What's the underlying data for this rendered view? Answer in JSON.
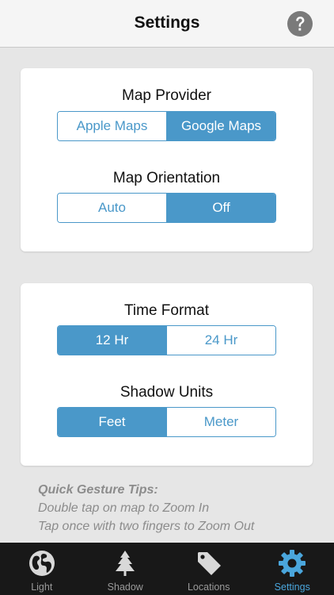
{
  "header": {
    "title": "Settings",
    "help_icon": "question-mark-icon"
  },
  "sections": {
    "map_provider": {
      "label": "Map Provider",
      "options": [
        "Apple Maps",
        "Google Maps"
      ],
      "selected": "Google Maps"
    },
    "map_orientation": {
      "label": "Map Orientation",
      "options": [
        "Auto",
        "Off"
      ],
      "selected": "Off"
    },
    "time_format": {
      "label": "Time Format",
      "options": [
        "12 Hr",
        "24 Hr"
      ],
      "selected": "12 Hr"
    },
    "shadow_units": {
      "label": "Shadow Units",
      "options": [
        "Feet",
        "Meter"
      ],
      "selected": "Feet"
    }
  },
  "tips": {
    "title": "Quick Gesture Tips:",
    "lines": [
      "Double tap on map to Zoom In",
      "Tap once with two fingers to Zoom Out"
    ]
  },
  "tabbar": {
    "tabs": [
      {
        "label": "Light",
        "icon": "globe-icon"
      },
      {
        "label": "Shadow",
        "icon": "tree-icon"
      },
      {
        "label": "Locations",
        "icon": "tag-icon"
      },
      {
        "label": "Settings",
        "icon": "gear-icon"
      }
    ],
    "active": "Settings"
  },
  "colors": {
    "accent": "#4a98c9",
    "tab_active": "#4aa6dc",
    "tabbar_bg": "#181818",
    "page_bg": "#e6e6e6"
  }
}
